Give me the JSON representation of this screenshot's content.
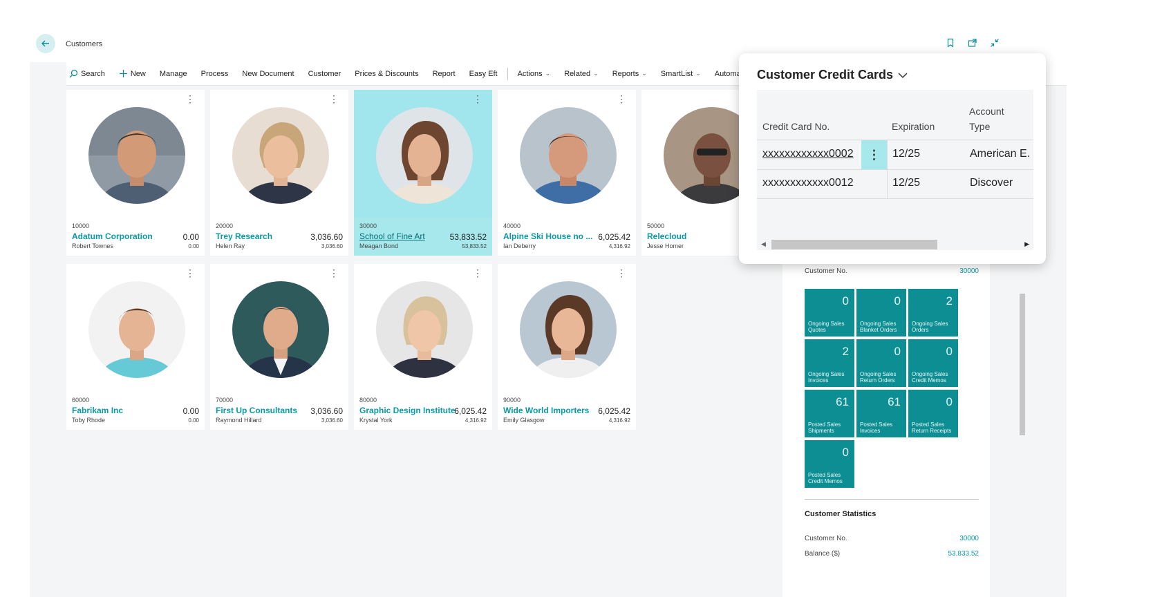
{
  "header": {
    "title": "Customers"
  },
  "actions": [
    {
      "label": "Search",
      "icon": "search-icon"
    },
    {
      "label": "New",
      "icon": "plus-icon"
    },
    {
      "label": "Manage"
    },
    {
      "label": "Process"
    },
    {
      "label": "New Document"
    },
    {
      "label": "Customer"
    },
    {
      "label": "Prices & Discounts"
    },
    {
      "label": "Report"
    },
    {
      "label": "Easy Eft"
    }
  ],
  "menus": [
    {
      "label": "Actions"
    },
    {
      "label": "Related"
    },
    {
      "label": "Reports"
    },
    {
      "label": "SmartList"
    },
    {
      "label": "Automat"
    }
  ],
  "customers": [
    {
      "no": "10000",
      "name": "Adatum Corporation",
      "contact": "Robert Townes",
      "balance": "0.00",
      "balance_due": "0.00"
    },
    {
      "no": "20000",
      "name": "Trey Research",
      "contact": "Helen Ray",
      "balance": "3,036.60",
      "balance_due": "3,036.60"
    },
    {
      "no": "30000",
      "name": "School of Fine Art",
      "contact": "Meagan Bond",
      "balance": "53,833.52",
      "balance_due": "53,833.52"
    },
    {
      "no": "40000",
      "name": "Alpine Ski House no ...",
      "contact": "Ian Deberry",
      "balance": "6,025.42",
      "balance_due": "4,316.92"
    },
    {
      "no": "50000",
      "name": "Relecloud",
      "contact": "Jesse Homer",
      "balance": "",
      "balance_due": ""
    },
    {
      "no": "60000",
      "name": "Fabrikam Inc",
      "contact": "Toby Rhode",
      "balance": "0.00",
      "balance_due": "0.00"
    },
    {
      "no": "70000",
      "name": "First Up Consultants",
      "contact": "Raymond Hillard",
      "balance": "3,036.60",
      "balance_due": "3,036.60"
    },
    {
      "no": "80000",
      "name": "Graphic Design Institute",
      "contact": "Krystal York",
      "balance": "6,025.42",
      "balance_due": "4,316.92"
    },
    {
      "no": "90000",
      "name": "Wide World Importers",
      "contact": "Emily Glasgow",
      "balance": "6,025.42",
      "balance_due": "4,316.92"
    }
  ],
  "factbox": {
    "customer_no_label": "Customer No.",
    "customer_no_value": "30000",
    "tiles": [
      {
        "value": "0",
        "label": "Ongoing Sales Quotes"
      },
      {
        "value": "0",
        "label": "Ongoing Sales Blanket Orders"
      },
      {
        "value": "2",
        "label": "Ongoing Sales Orders"
      },
      {
        "value": "2",
        "label": "Ongoing Sales Invoices"
      },
      {
        "value": "0",
        "label": "Ongoing Sales Return Orders"
      },
      {
        "value": "0",
        "label": "Ongoing Sales Credit Memos"
      },
      {
        "value": "61",
        "label": "Posted Sales Shipments"
      },
      {
        "value": "61",
        "label": "Posted Sales Invoices"
      },
      {
        "value": "0",
        "label": "Posted Sales Return Receipts"
      },
      {
        "value": "0",
        "label": "Posted Sales Credit Memos"
      }
    ],
    "stats_title": "Customer Statistics",
    "stats_customer_no_label": "Customer No.",
    "stats_customer_no_value": "30000",
    "stats_balance_label": "Balance ($)",
    "stats_balance_value": "53,833.52"
  },
  "popup": {
    "title": "Customer Credit Cards",
    "columns": {
      "card_no": "Credit Card No.",
      "expiration": "Expiration",
      "account_type_1": "Account",
      "account_type_2": "Type"
    },
    "rows": [
      {
        "card_no": "xxxxxxxxxxxx0002",
        "expiration": "12/25",
        "account_type": "American E."
      },
      {
        "card_no": "xxxxxxxxxxxx0012",
        "expiration": "12/25",
        "account_type": "Discover"
      }
    ]
  },
  "colors": {
    "accent": "#0a9aa5",
    "tile": "#0c8e93",
    "selected": "#a6e8ec"
  }
}
